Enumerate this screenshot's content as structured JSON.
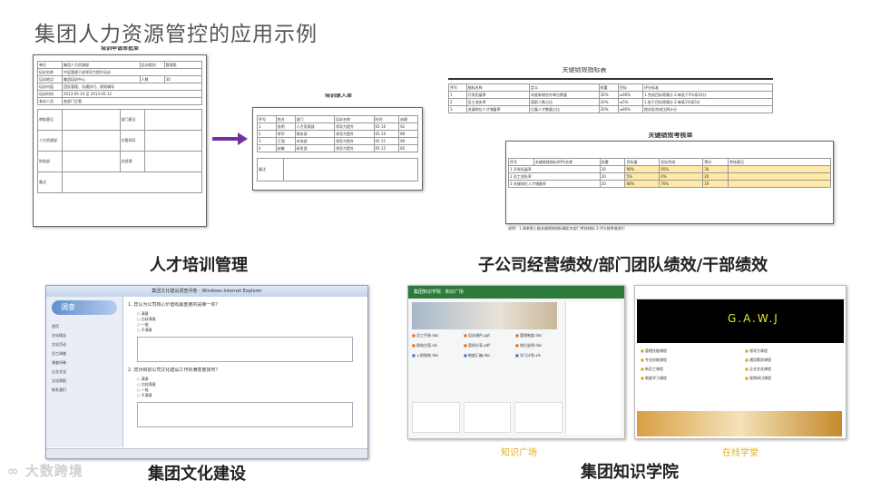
{
  "page": {
    "title": "集团人力资源管控的应用示例"
  },
  "captions": {
    "training": "人才培训管理",
    "performance": "子公司经营绩效/部门团队绩效/干部绩效",
    "culture": "集团文化建设",
    "academy": "集团知识学院"
  },
  "training": {
    "approval_title": "培训申请审批单",
    "import_title": "培训录入单",
    "fields": [
      "单位",
      "培训名称",
      "培训类别",
      "培训地点",
      "培训内容",
      "培训时间",
      "参训人员",
      "审批意见"
    ]
  },
  "performance": {
    "indicator_title": "关键绩效指标表",
    "review_title": "关键绩效考核单",
    "headers": [
      "序号",
      "关键绩效指标(KPI)名称",
      "权重",
      "目标值",
      "实际完成",
      "得分"
    ],
    "rows": [
      "1  开发拓展率",
      "2  员工流失率",
      "3  关键岗位人才储备率"
    ],
    "footer": "说明：1.请参照上级关键绩效指标确定本部门考核指标 2.评分按季度进行"
  },
  "culture": {
    "logo": "调查",
    "window_title": "集团文化建设调查问卷 - Windows Internet Explorer",
    "nav": [
      "首页",
      "文化理念",
      "文化活动",
      "员工调查",
      "调查问卷",
      "企业文化",
      "文化简报",
      "联系我们"
    ],
    "question_1": "1. 您认为公司核心价值观最重要的是哪一项？",
    "question_2": "2. 您对目前公司文化建设工作的满意度如何？",
    "options": [
      "满意",
      "比较满意",
      "一般",
      "不满意"
    ]
  },
  "academy": {
    "left_label": "知识广场",
    "right_label": "在线学堂",
    "left_banner": "集团知识学院 · 知识广场",
    "logo_text": "G.A.W.J"
  },
  "brand": {
    "watermark": "大数跨境"
  },
  "colors": {
    "arrow": "#7030a0",
    "link_blue": "#1d47b5",
    "highlight": "#ffe9a8",
    "academy_green": "#2d7a3a"
  }
}
